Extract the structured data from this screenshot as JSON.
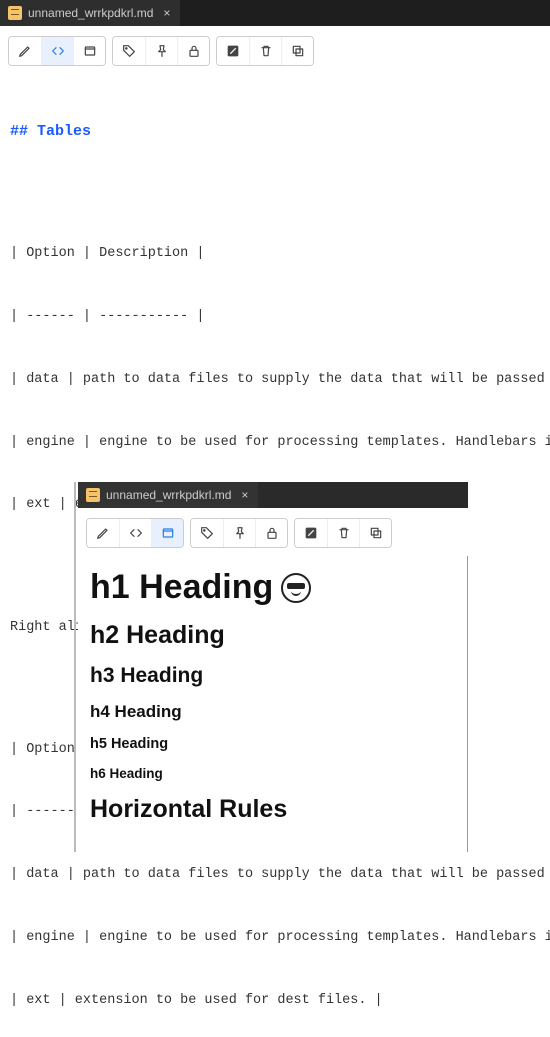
{
  "top": {
    "tab": {
      "filename": "unnamed_wrrkpdkrl.md"
    }
  },
  "toolbar_top": {
    "active": "code"
  },
  "source": {
    "heading": "## Tables",
    "table1": [
      "| Option | Description |",
      "| ------ | ----------- |",
      "| data   | path to data files to supply the data that will be passed into templates. |",
      "| engine | engine to be used for processing templates. Handlebars is the default. |",
      "| ext    | extension to be used for dest files. |"
    ],
    "caption": "Right aligned columns",
    "table2": [
      "| Option | Description |",
      "| ------:| -----------:|",
      "| data   | path to data files to supply the data that will be passed into templates. |",
      "| engine | engine to be used for processing templates. Handlebars is the default. |",
      "| ext    | extension to be used for dest files. |"
    ]
  },
  "sub": {
    "tab": {
      "filename": "unnamed_wrrkpdkrl.md"
    },
    "toolbar": {
      "active": "preview"
    },
    "preview": {
      "h1": "h1 Heading",
      "h2": "h2 Heading",
      "h3": "h3 Heading",
      "h4": "h4 Heading",
      "h5": "h5 Heading",
      "h6": "h6 Heading",
      "hr_title": "Horizontal Rules"
    }
  }
}
